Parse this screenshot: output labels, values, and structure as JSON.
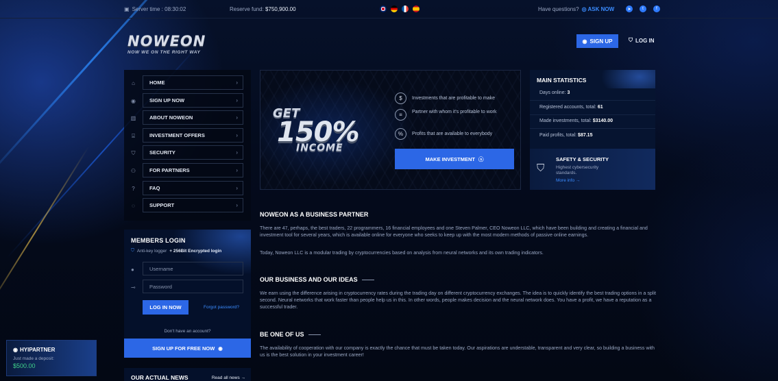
{
  "topbar": {
    "server_time": "Server time : 08:30:02",
    "reserve_label": "Reserve fund:",
    "reserve_value": "$750,900.00",
    "questions": "Have questions?",
    "ask_now": "ASK NOW"
  },
  "logo": {
    "name": "NOWEON",
    "tagline": "NOW WE ON THE RIGHT WAY"
  },
  "header": {
    "signup": "SIGN UP",
    "login": "LOG IN"
  },
  "nav": {
    "items": [
      {
        "label": "HOME",
        "icon": "home-icon"
      },
      {
        "label": "SIGN UP NOW",
        "icon": "user-icon"
      },
      {
        "label": "ABOUT NOWEON",
        "icon": "chart-icon"
      },
      {
        "label": "INVESTMENT OFFERS",
        "icon": "bank-icon"
      },
      {
        "label": "SECURITY",
        "icon": "shield-icon"
      },
      {
        "label": "FOR PARTNERS",
        "icon": "partners-icon"
      },
      {
        "label": "FAQ",
        "icon": "question-icon"
      },
      {
        "label": "SUPPORT",
        "icon": "chat-icon"
      }
    ]
  },
  "login": {
    "title": "MEMBERS LOGIN",
    "anti_prefix": "Anti-key logger",
    "anti_bold": "+ 256Bit Encrypted login",
    "username_placeholder": "Username",
    "password_placeholder": "Password",
    "button": "LOG IN NOW",
    "forgot": "Forgot password?",
    "no_account": "Don't have an account?",
    "free_button": "SIGN UP FOR FREE NOW"
  },
  "news": {
    "title": "OUR ACTUAL NEWS",
    "read_all": "Read all news →"
  },
  "hyip": {
    "title": "HYIPARTNER",
    "subtitle": "Just made a deposit:",
    "value": "$500.00"
  },
  "hero": {
    "get": "GET",
    "percent": "150%",
    "income": "INCOME",
    "features": [
      "Investments that are profitable to make",
      "Partner with whom it's profitable to work",
      "Profits that are available to everybody"
    ],
    "button": "MAKE INVESTMENT"
  },
  "stats": {
    "title": "MAIN STATISTICS",
    "rows": [
      {
        "label": "Days online:",
        "value": "3"
      },
      {
        "label": "Registered accounts, total:",
        "value": "61"
      },
      {
        "label": "Made investments, total:",
        "value": "$3140.00"
      },
      {
        "label": "Paid profits, total:",
        "value": "$87.15"
      }
    ],
    "safety_title": "SAFETY & SECURITY",
    "safety_desc": "Highest cybersecurity standards.",
    "safety_more": "More info →"
  },
  "content": {
    "s1_title": "NOWEON AS A BUSINESS PARTNER",
    "s1_p1": "There are 47, perhaps, the best traders, 22 programmers, 16 financial employees and one Steven Palmer, CEO Noweon LLC, which have been building and creating a financial and investment tool for several years, which is available online for everyone who seeks to keep up with the most modern methods of passive online earnings.",
    "s1_p2": "Today, Noweon LLC is a modular trading by cryptocurrencies based on analysis from neural networks and its own trading indicators.",
    "s2_title": "OUR BUSINESS AND OUR IDEAS",
    "s2_p1": "We earn using the difference arising in cryptocurrency rates during the trading day on different cryptocurrency exchanges. The idea is to quickly identify the best trading options in a split second. Neural networks that work faster than people help us in this. In other words, people makes decision and the neural network does. You have a profit, we have a reputation as a successful trader.",
    "s3_title": "BE ONE OF US",
    "s3_p1": "The availability of cooperation with our company is exactly the chance that must be taken today. Our aspirations are understable, transparent and very clear, so building a business with us is the best solution in your investment career!"
  },
  "colors": {
    "accent": "#2c67e6",
    "link": "#3b8cff",
    "positive": "#3fd28b"
  }
}
